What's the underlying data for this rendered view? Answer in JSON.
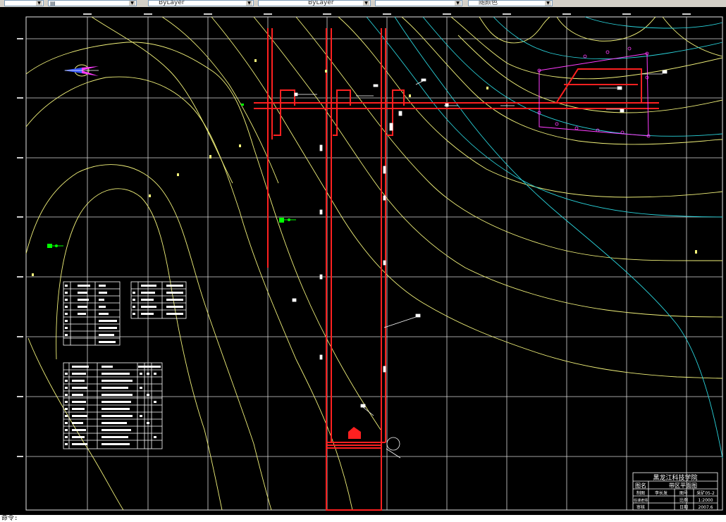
{
  "toolbar": {
    "combo1_value": "",
    "combo2_value": "",
    "combo3_value": "ByLayer",
    "combo4_value": "ByLayer",
    "combo5_value": "",
    "combo6_value": "随颜色",
    "layer_icon": "layer-icon",
    "dropdown_icon": "chevron-down-icon"
  },
  "colors": {
    "background": "#000000",
    "grid": "#e6e6e6",
    "contour_yellow": "#f2f27a",
    "contour_cyan": "#2ad4dc",
    "roadway_red": "#ff2020",
    "boundary_magenta": "#ff3cff",
    "marker_green": "#00ff00"
  },
  "title_block": {
    "institute": "黑龙江科技学院",
    "drawing_name_label": "图名",
    "drawing_name": "带区平面图",
    "row1_c1": "制图",
    "row1_c2": "李长发",
    "row1_c3": "图号",
    "row1_c4": "采矿05-2",
    "row2_c1": "任课老师",
    "row2_c2": "",
    "row2_c3": "比例",
    "row2_c4": "1:2000",
    "row3_c1": "审核",
    "row3_c2": "",
    "row3_c3": "日期",
    "row3_c4": "2007.6"
  },
  "command_line": {
    "prompt": "命令:"
  }
}
